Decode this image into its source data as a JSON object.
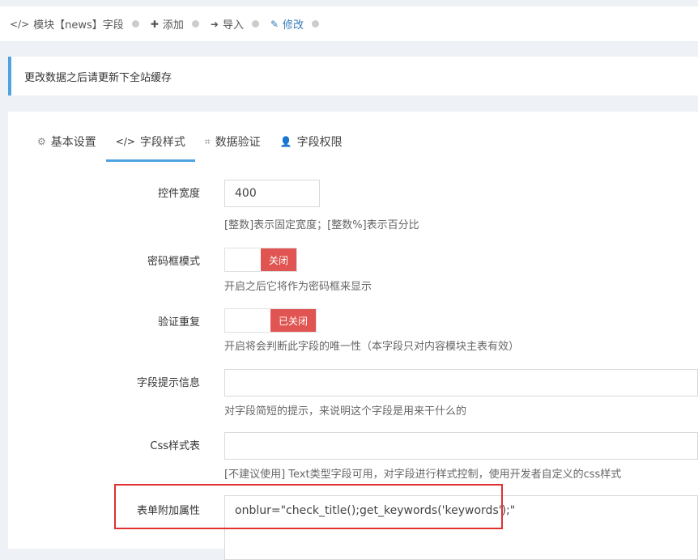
{
  "breadcrumb": {
    "module": "模块【news】字段",
    "add": "添加",
    "import": "导入",
    "edit": "修改"
  },
  "notice": "更改数据之后请更新下全站缓存",
  "tabs": [
    {
      "label": "基本设置",
      "icon": "gear-icon"
    },
    {
      "label": "字段样式",
      "icon": "code-icon"
    },
    {
      "label": "数据验证",
      "icon": "crop-icon"
    },
    {
      "label": "字段权限",
      "icon": "user-icon"
    }
  ],
  "form": {
    "width": {
      "label": "控件宽度",
      "value": "400",
      "help": "[整数]表示固定宽度；[整数%]表示百分比"
    },
    "password": {
      "label": "密码框模式",
      "state": "关闭",
      "help": "开启之后它将作为密码框来显示"
    },
    "unique": {
      "label": "验证重复",
      "state": "已关闭",
      "help": "开启将会判断此字段的唯一性（本字段只对内容模块主表有效）"
    },
    "tips": {
      "label": "字段提示信息",
      "value": "",
      "help": "对字段简短的提示，来说明这个字段是用来干什么的"
    },
    "css": {
      "label": "Css样式表",
      "value": "",
      "help": "[不建议使用] Text类型字段可用，对字段进行样式控制，使用开发者自定义的css样式"
    },
    "attr": {
      "label": "表单附加属性",
      "value": "onblur=\"check_title();get_keywords('keywords');\""
    }
  },
  "colors": {
    "accent": "#4fa3e0",
    "danger": "#e05551",
    "highlight": "#e03030"
  }
}
